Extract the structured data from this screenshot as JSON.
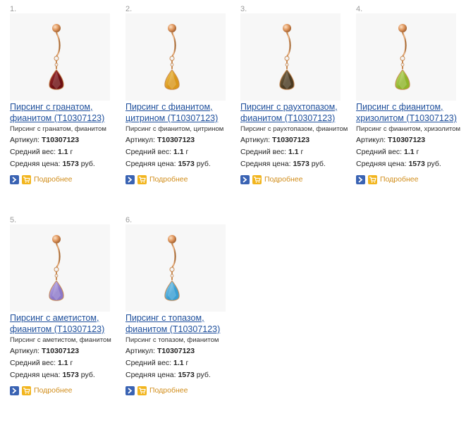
{
  "products": [
    {
      "num": "1.",
      "title": "Пирсинг с гранатом, фианитом (T10307123)",
      "desc": "Пирсинг с гранатом, фианитом",
      "sku_label": "Артикул:",
      "sku": "T10307123",
      "weight_label": "Средний вес:",
      "weight": "1.1",
      "weight_unit": "г",
      "price_label": "Средняя цена:",
      "price": "1573",
      "price_unit": "руб.",
      "more_label": "Подробнее",
      "stone_color": "#6e0f12",
      "stone_highlight": "#b33a3a"
    },
    {
      "num": "2.",
      "title": "Пирсинг с фианитом, цитрином (T10307123)",
      "desc": "Пирсинг с фианитом, цитрином",
      "sku_label": "Артикул:",
      "sku": "T10307123",
      "weight_label": "Средний вес:",
      "weight": "1.1",
      "weight_unit": "г",
      "price_label": "Средняя цена:",
      "price": "1573",
      "price_unit": "руб.",
      "more_label": "Подробнее",
      "stone_color": "#d9971b",
      "stone_highlight": "#f5d36a"
    },
    {
      "num": "3.",
      "title": "Пирсинг с раухтопазом, фианитом (T10307123)",
      "desc": "Пирсинг с раухтопазом, фианитом",
      "sku_label": "Артикул:",
      "sku": "T10307123",
      "weight_label": "Средний вес:",
      "weight": "1.1",
      "weight_unit": "г",
      "price_label": "Средняя цена:",
      "price": "1573",
      "price_unit": "руб.",
      "more_label": "Подробнее",
      "stone_color": "#4a3a22",
      "stone_highlight": "#8b7550"
    },
    {
      "num": "4.",
      "title": "Пирсинг с фианитом, хризолитом (T10307123)",
      "desc": "Пирсинг с фианитом, хризолитом",
      "sku_label": "Артикул:",
      "sku": "T10307123",
      "weight_label": "Средний вес:",
      "weight": "1.1",
      "weight_unit": "г",
      "price_label": "Средняя цена:",
      "price": "1573",
      "price_unit": "руб.",
      "more_label": "Подробнее",
      "stone_color": "#8fb52a",
      "stone_highlight": "#d3e987"
    },
    {
      "num": "5.",
      "title": "Пирсинг с аметистом, фианитом (T10307123)",
      "desc": "Пирсинг с аметистом, фианитом",
      "sku_label": "Артикул:",
      "sku": "T10307123",
      "weight_label": "Средний вес:",
      "weight": "1.1",
      "weight_unit": "г",
      "price_label": "Средняя цена:",
      "price": "1573",
      "price_unit": "руб.",
      "more_label": "Подробнее",
      "stone_color": "#8c78c9",
      "stone_highlight": "#cfc3f0"
    },
    {
      "num": "6.",
      "title": "Пирсинг с топазом, фианитом (T10307123)",
      "desc": "Пирсинг с топазом, фианитом",
      "sku_label": "Артикул:",
      "sku": "T10307123",
      "weight_label": "Средний вес:",
      "weight": "1.1",
      "weight_unit": "г",
      "price_label": "Средняя цена:",
      "price": "1573",
      "price_unit": "руб.",
      "more_label": "Подробнее",
      "stone_color": "#3a9fd3",
      "stone_highlight": "#a6dcf5"
    }
  ]
}
